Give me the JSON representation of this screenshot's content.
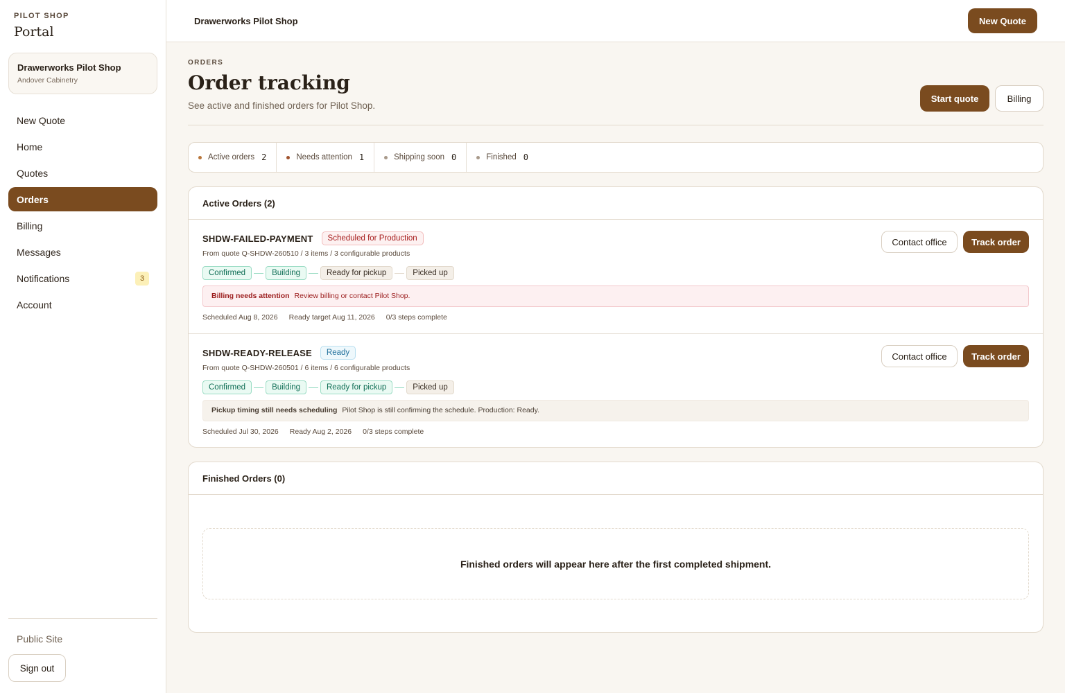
{
  "sidebar": {
    "brand_eyebrow": "PILOT SHOP",
    "brand_title": "Portal",
    "account": {
      "name": "Drawerworks Pilot Shop",
      "company": "Andover Cabinetry"
    },
    "nav": [
      {
        "label": "New Quote"
      },
      {
        "label": "Home"
      },
      {
        "label": "Quotes"
      },
      {
        "label": "Orders",
        "active": true
      },
      {
        "label": "Billing"
      },
      {
        "label": "Messages"
      },
      {
        "label": "Notifications",
        "badge": "3"
      },
      {
        "label": "Account"
      }
    ],
    "public_site": "Public Site",
    "sign_out": "Sign out"
  },
  "topbar": {
    "title": "Drawerworks Pilot Shop",
    "new_quote": "New Quote"
  },
  "header": {
    "eyebrow": "ORDERS",
    "title": "Order tracking",
    "subtitle": "See active and finished orders for Pilot Shop.",
    "start_quote": "Start quote",
    "billing": "Billing"
  },
  "stats": [
    {
      "label": "Active orders",
      "count": "2",
      "dot_color": "#b8753a"
    },
    {
      "label": "Needs attention",
      "count": "1",
      "dot_color": "#a0522d"
    },
    {
      "label": "Shipping soon",
      "count": "0",
      "dot_color": "#a8998a"
    },
    {
      "label": "Finished",
      "count": "0",
      "dot_color": "#a8998a"
    }
  ],
  "active_orders": {
    "heading": "Active Orders (2)",
    "orders": [
      {
        "id": "SHDW-FAILED-PAYMENT",
        "status": "Scheduled for Production",
        "meta": "From quote Q-SHDW-260510 / 3 items / 3 configurable products",
        "steps": [
          "Confirmed",
          "Building",
          "Ready for pickup",
          "Picked up"
        ],
        "notice_title": "Billing needs attention",
        "notice_text": "Review billing or contact Pilot Shop.",
        "foot": [
          "Scheduled Aug 8, 2026",
          "Ready target Aug 11, 2026",
          "0/3 steps complete"
        ],
        "contact": "Contact office",
        "track": "Track order"
      },
      {
        "id": "SHDW-READY-RELEASE",
        "status": "Ready",
        "meta": "From quote Q-SHDW-260501 / 6 items / 6 configurable products",
        "steps": [
          "Confirmed",
          "Building",
          "Ready for pickup",
          "Picked up"
        ],
        "notice_title": "Pickup timing still needs scheduling",
        "notice_text": "Pilot Shop is still confirming the schedule. Production: Ready.",
        "foot": [
          "Scheduled Jul 30, 2026",
          "Ready Aug 2, 2026",
          "0/3 steps complete"
        ],
        "contact": "Contact office",
        "track": "Track order"
      }
    ]
  },
  "finished_orders": {
    "heading": "Finished Orders (0)",
    "empty": "Finished orders will appear here after the first completed shipment."
  }
}
